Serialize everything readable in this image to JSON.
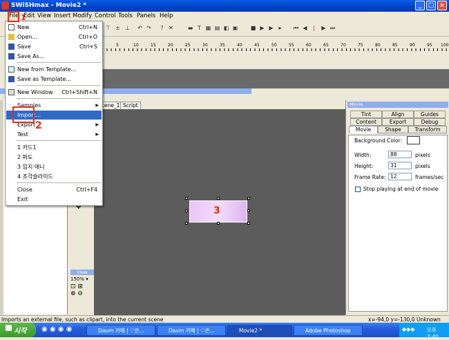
{
  "window": {
    "title": "SWiSHmax - Movie2 *"
  },
  "menubar": [
    "File",
    "Edit",
    "View",
    "Insert",
    "Modify",
    "Control",
    "Tools",
    "Panels",
    "Help"
  ],
  "ruler_numbers": [
    "5",
    "10",
    "15",
    "20",
    "25",
    "30",
    "35",
    "40",
    "45",
    "50",
    "55",
    "60",
    "65",
    "70",
    "75",
    "80",
    "85",
    "90",
    "95",
    "100"
  ],
  "file_menu": {
    "new": {
      "label": "New",
      "shortcut": "Ctrl+N"
    },
    "open": {
      "label": "Open...",
      "shortcut": "Ctrl+O"
    },
    "save": {
      "label": "Save",
      "shortcut": "Ctrl+S"
    },
    "save_as": {
      "label": "Save As..."
    },
    "new_from_template": {
      "label": "New from Template..."
    },
    "save_as_template": {
      "label": "Save as Template..."
    },
    "new_window": {
      "label": "New Window",
      "shortcut": "Ctrl+Shift+N"
    },
    "samples": {
      "label": "Samples"
    },
    "import": {
      "label": "Import..."
    },
    "export": {
      "label": "Export"
    },
    "test": {
      "label": "Test"
    },
    "recent": [
      "1 카드1",
      "2 파도",
      "3 임지 애니",
      "4 조각슬라이드"
    ],
    "close": {
      "label": "Close",
      "shortcut": "Ctrl+F4"
    },
    "exit": {
      "label": "Exit"
    }
  },
  "stage_tabs": [
    "Scene_1",
    "Script"
  ],
  "view_panel": {
    "title": "View",
    "zoom": "150%"
  },
  "movie_panel": {
    "title": "Movie",
    "tabs_row1": [
      "Tint",
      "Align",
      "Guides"
    ],
    "tabs_row2": [
      "Content",
      "Export",
      "Debug"
    ],
    "tabs_row3": [
      "Movie",
      "Shape",
      "Transform"
    ],
    "background_color_label": "Background Color:",
    "width_label": "Width:",
    "width_value": "88",
    "width_unit": "pixels",
    "height_label": "Height:",
    "height_value": "31",
    "height_unit": "pixels",
    "frame_rate_label": "Frame Rate:",
    "frame_rate_value": "12",
    "frame_rate_unit": "frames/sec",
    "stop_playing_label": "Stop playing at end of movie"
  },
  "annotations": [
    "1",
    "2",
    "3"
  ],
  "status": {
    "hint": "Imports an external file, such as clipart, into the current scene",
    "coords": "x=-94,0 y=-130,0",
    "size": "Unknown Size"
  },
  "taskbar": {
    "start_label": "시작",
    "tasks": [
      "Daum 카페 | ♡은...",
      "Daum 카페 | ♡은...",
      "Movie2 *",
      "Adobe Photoshop"
    ],
    "clock": "오후 7:40"
  },
  "colors": {
    "title_blue": "#0040c8",
    "highlight": "#316ac5",
    "annotation_red": "#e03010",
    "stage_gray": "#5c5c5c"
  }
}
